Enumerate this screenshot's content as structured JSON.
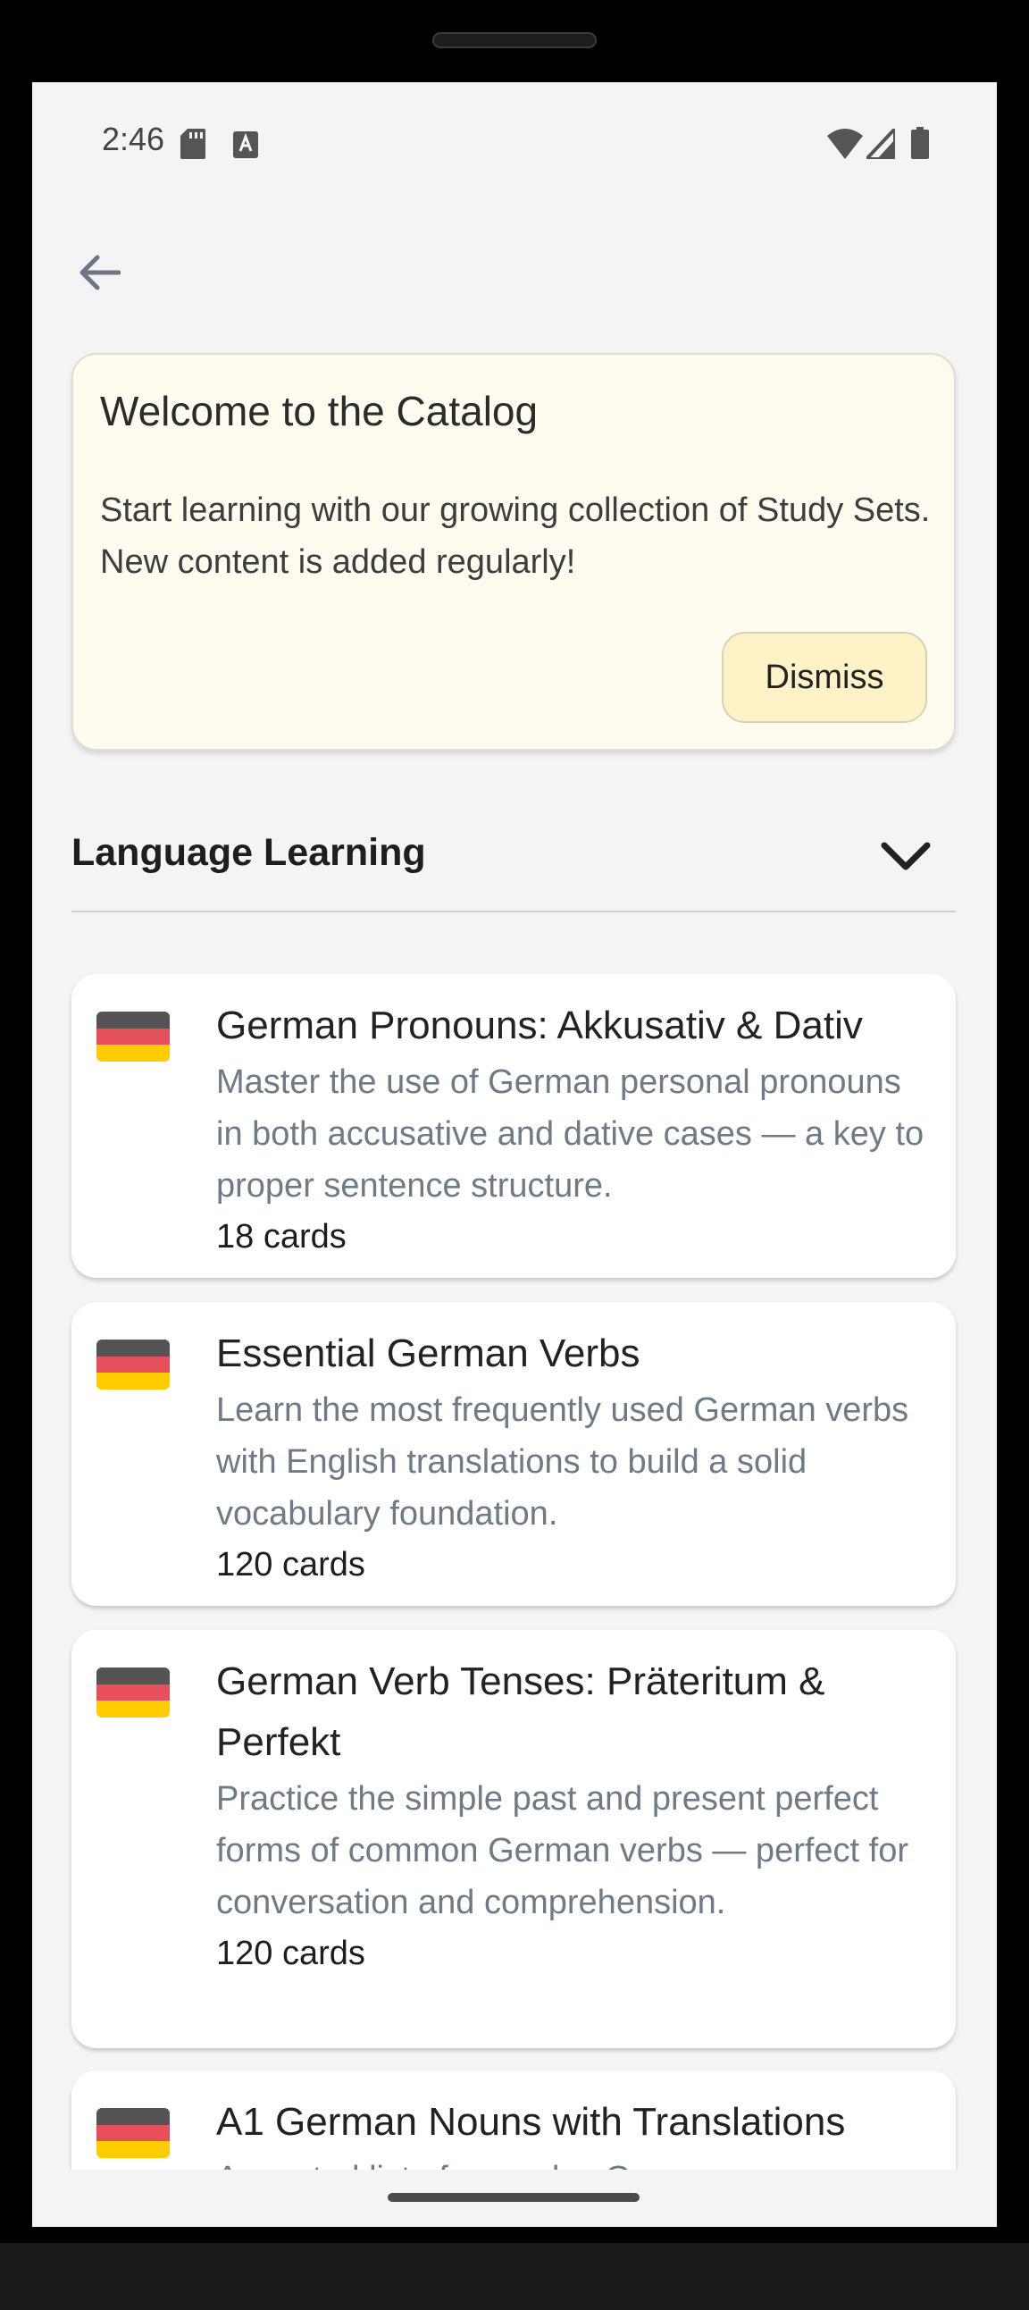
{
  "status_bar": {
    "time": "2:46",
    "icons": [
      "sd-card-icon",
      "text-a-icon",
      "wifi-icon",
      "signal-icon",
      "battery-icon"
    ]
  },
  "back_button": {
    "icon": "arrow-left-icon"
  },
  "welcome": {
    "title": "Welcome to the Catalog",
    "body": "Start learning with our growing collection of Study Sets. New content is added regularly!",
    "dismiss_label": "Dismiss"
  },
  "section": {
    "title": "Language Learning",
    "icon": "chevron-down-icon"
  },
  "study_sets": [
    {
      "title": "German Pronouns: Akkusativ & Dativ",
      "description": "Master the use of German personal pronouns in both accusative and dative cases — a key to proper sentence structure.",
      "count": "18 cards",
      "flag": "german-flag-icon"
    },
    {
      "title": "Essential German Verbs",
      "description": "Learn the most frequently used German verbs with English translations to build a solid vocabulary foundation.",
      "count": "120 cards",
      "flag": "german-flag-icon"
    },
    {
      "title": "German Verb Tenses: Präteritum & Perfekt",
      "description": "Practice the simple past and present perfect forms of common German verbs — perfect for conversation and comprehension.",
      "count": "120 cards",
      "flag": "german-flag-icon"
    },
    {
      "title": "A1 German Nouns with Translations",
      "description": "A curated list of everyday German nouns",
      "count": "",
      "flag": "german-flag-icon"
    }
  ],
  "colors": {
    "background": "#f4f4f4",
    "welcome_card": "#fffbee",
    "dismiss_button": "#fff2c7",
    "description_text": "#6f7a87",
    "flag_black": "#545454",
    "flag_red": "#e5505b",
    "flag_gold": "#ffcc00"
  }
}
